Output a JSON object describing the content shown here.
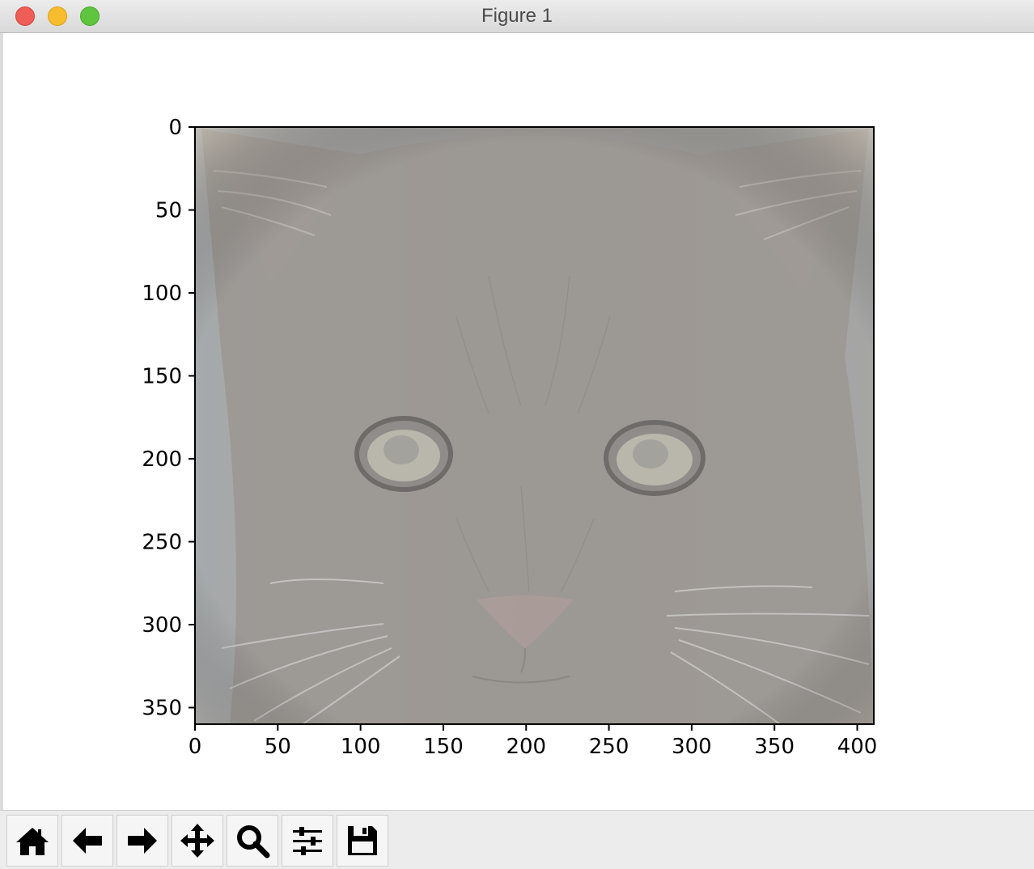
{
  "window": {
    "title": "Figure 1"
  },
  "toolbar": {
    "buttons": [
      {
        "name": "home-button",
        "icon": "home-icon"
      },
      {
        "name": "back-button",
        "icon": "arrow-left-icon"
      },
      {
        "name": "forward-button",
        "icon": "arrow-right-icon"
      },
      {
        "name": "pan-button",
        "icon": "move-icon"
      },
      {
        "name": "zoom-button",
        "icon": "magnifier-icon"
      },
      {
        "name": "configure-subplots-button",
        "icon": "sliders-icon"
      },
      {
        "name": "save-button",
        "icon": "floppy-disk-icon"
      }
    ]
  },
  "plot": {
    "image_description": "grayish high-pass filtered kitten face",
    "xlim": [
      0,
      410
    ],
    "ylim": [
      360,
      0
    ],
    "x_ticks": [
      "0",
      "50",
      "100",
      "150",
      "200",
      "250",
      "300",
      "350",
      "400"
    ],
    "y_ticks": [
      "0",
      "50",
      "100",
      "150",
      "200",
      "250",
      "300",
      "350"
    ]
  },
  "colors": {
    "image_base": "#9a9692",
    "axis": "#000000",
    "titlebar": "#e3e3e3",
    "toolbar": "#ececec"
  }
}
